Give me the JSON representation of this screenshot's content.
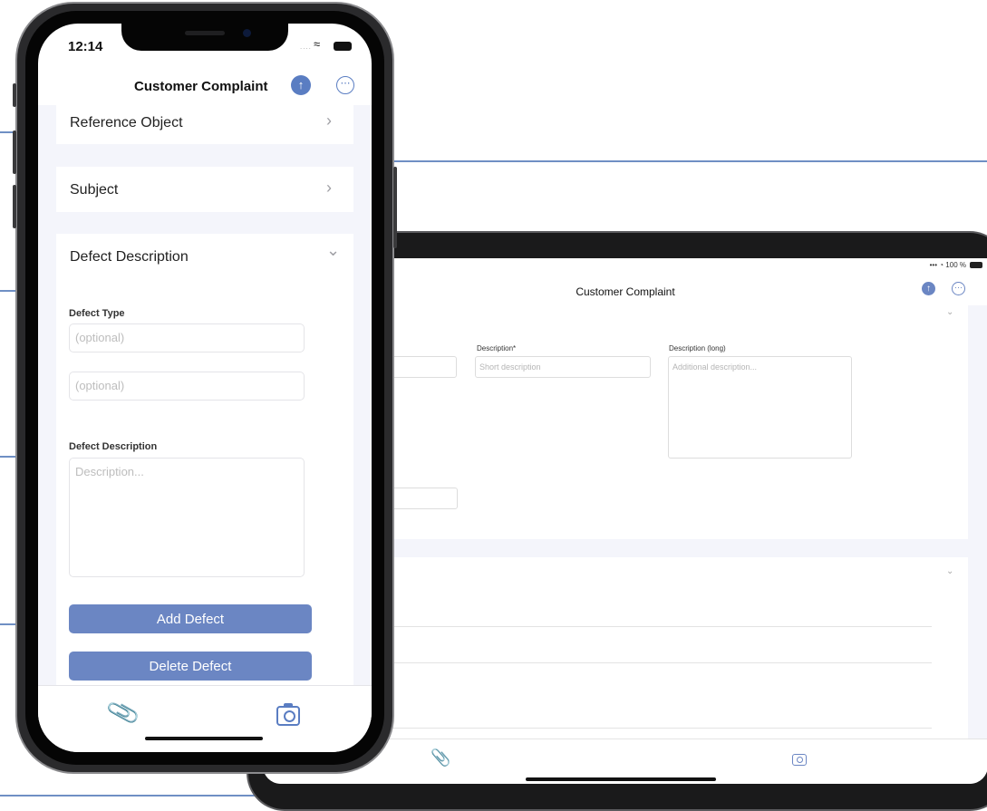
{
  "phone": {
    "status": {
      "time": "12:14",
      "signal": "....",
      "wifi": "◔"
    },
    "nav": {
      "title": "Customer Complaint",
      "upload_glyph": "↑",
      "more_glyph": "⋯"
    },
    "sections": [
      {
        "title": "Reference Object",
        "chevron": "›"
      },
      {
        "title": "Subject",
        "chevron": "›"
      },
      {
        "title": "Defect Description",
        "chevron": "⌄"
      }
    ],
    "defect": {
      "type_label": "Defect Type",
      "type_placeholder": "(optional)",
      "second_placeholder": "(optional)",
      "desc_label": "Defect Description",
      "desc_placeholder": "Description...",
      "add_button": "Add Defect",
      "delete_button": "Delete Defect"
    },
    "toolbar": {
      "attachment_icon": "paperclip-icon",
      "camera_icon": "camera-icon"
    }
  },
  "tablet": {
    "status": {
      "text": "••• ◔ 100 %"
    },
    "nav": {
      "title": "Customer Complaint",
      "upload_glyph": "↑",
      "more_glyph": "⋯"
    },
    "form": {
      "description_label": "Description*",
      "description_placeholder": "Short description",
      "long_label": "Description (long)",
      "long_placeholder": "Additional description..."
    },
    "chevron": "⌄",
    "toolbar": {
      "attachment_icon": "paperclip-icon",
      "camera_icon": "camera-icon"
    }
  },
  "colors": {
    "accent": "#6b86c3",
    "guide_line": "#6f8fc4",
    "background": "#f4f5fb"
  }
}
